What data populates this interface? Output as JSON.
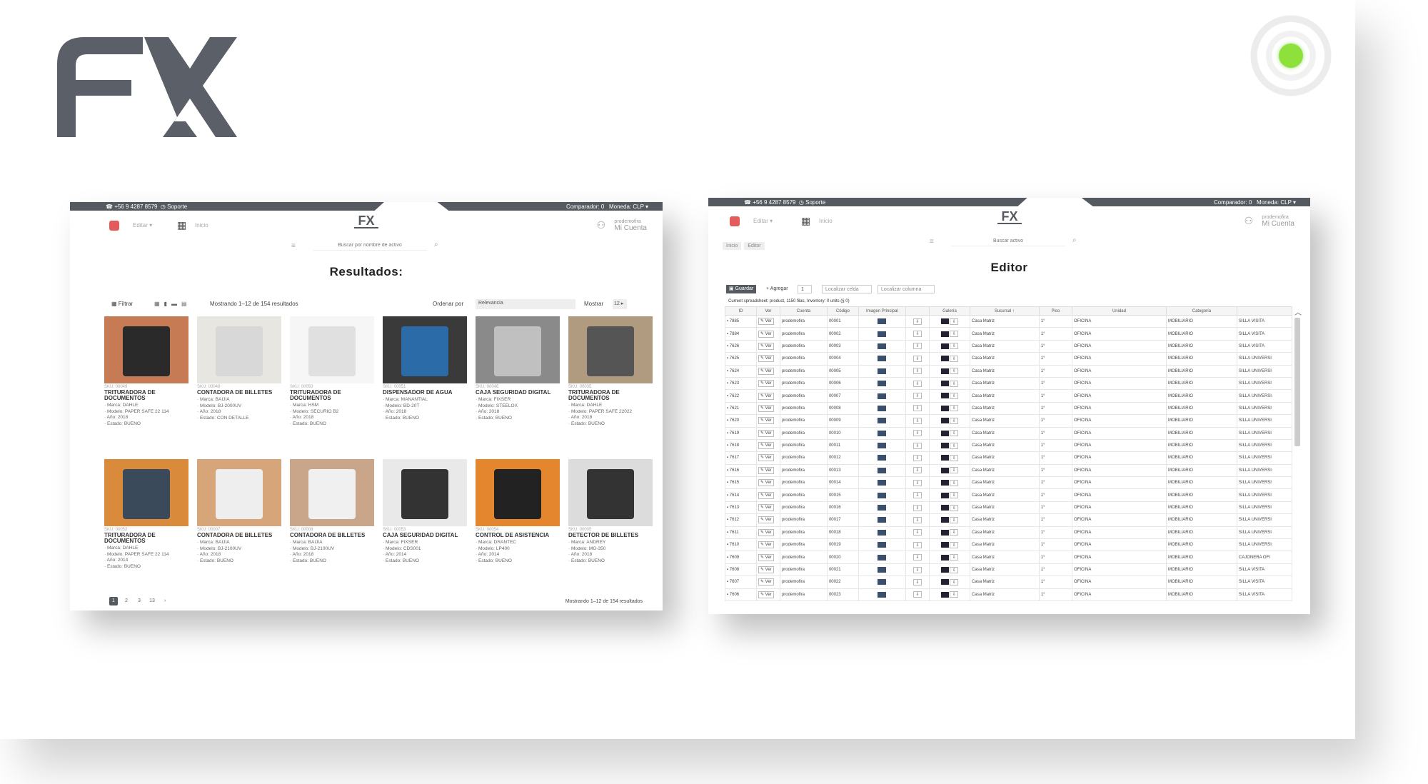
{
  "colors": {
    "dark_gray": "#555a61",
    "green_dot": "#8ee03b",
    "red_menu": "#e35b5b"
  },
  "logo": {
    "text": "FX"
  },
  "catalog": {
    "topbar": {
      "phone": "☎ +56 9 4287 8579",
      "support": "◷ Soporte",
      "comparator": "Comparador: 0",
      "currency": "Moneda: CLP ▾"
    },
    "menu_label": "Editar ▾",
    "home_label": "Inicio",
    "account": {
      "small": "prodemofira",
      "label": "Mi Cuenta"
    },
    "search_placeholder": "Buscar por nombre de activo",
    "title": "Resultados:",
    "filter": "▦ Filtrar",
    "view_icons": "▦▮▬▤",
    "showing": "Mostrando 1–12 de 154 resultados",
    "order_label": "Ordenar por",
    "order_value": "Relevancia",
    "show_label": "Mostrar",
    "show_value": "12 ▸",
    "products": [
      {
        "sku": "SKU: 00049",
        "title": "TRITURADORA DE DOCUMENTOS",
        "specs": [
          "Marca: DAHLE",
          "Modelo: PAPER SAFE 22 114",
          "Año: 2018",
          "Estado: BUENO"
        ],
        "bg": "#c77b55",
        "obj": "#2a2a2a"
      },
      {
        "sku": "SKU: 00048",
        "title": "CONTADORA DE BILLETES",
        "specs": [
          "Marca: BAIJIA",
          "Modelo: BJ-2000UV",
          "Año: 2018",
          "Estado: CON DETALLE"
        ],
        "bg": "#e8e6e0",
        "obj": "#d8d8d8"
      },
      {
        "sku": "SKU: 00050",
        "title": "TRITURADORA DE DOCUMENTOS",
        "specs": [
          "Marca: HSM",
          "Modelo: SECURIO B2",
          "Año: 2018",
          "Estado: BUENO"
        ],
        "bg": "#f6f6f6",
        "obj": "#e0e0e0"
      },
      {
        "sku": "SKU: 00051",
        "title": "DISPENSADOR DE AGUA",
        "specs": [
          "Marca: MANANTIAL",
          "Modelo: BD-20T",
          "Año: 2018",
          "Estado: BUENO"
        ],
        "bg": "#3a3a3a",
        "obj": "#2b6ca8"
      },
      {
        "sku": "SKU: 00046",
        "title": "CAJA SEGURIDAD DIGITAL",
        "specs": [
          "Marca: FIXSER",
          "Modelo: STEELOX",
          "Año: 2018",
          "Estado: BUENO"
        ],
        "bg": "#8a8a8a",
        "obj": "#c0c0c0"
      },
      {
        "sku": "SKU: 00035",
        "title": "TRITURADORA DE DOCUMENTOS",
        "specs": [
          "Marca: DAHLE",
          "Modelo: PAPER SAFE 22022",
          "Año: 2018",
          "Estado: BUENO"
        ],
        "bg": "#b09a80",
        "obj": "#555"
      },
      {
        "sku": "SKU: 00052",
        "title": "TRITURADORA DE DOCUMENTOS",
        "specs": [
          "Marca: DAHLE",
          "Modelo: PAPER SAFE 22 114",
          "Año: 2014",
          "Estado: BUENO"
        ],
        "bg": "#d98a3a",
        "obj": "#3a4a5a"
      },
      {
        "sku": "SKU: 00007",
        "title": "CONTADORA DE BILLETES",
        "specs": [
          "Marca: BAIJIA",
          "Modelo: BJ-2100UV",
          "Año: 2018",
          "Estado: BUENO"
        ],
        "bg": "#d7a57a",
        "obj": "#eee"
      },
      {
        "sku": "SKU: 00008",
        "title": "CONTADORA DE BILLETES",
        "specs": [
          "Marca: BAIJIA",
          "Modelo: BJ-2100UV",
          "Año: 2018",
          "Estado: BUENO"
        ],
        "bg": "#c9a58a",
        "obj": "#f0f0f0"
      },
      {
        "sku": "SKU: 00053",
        "title": "CAJA SEGURIDAD DIGITAL",
        "specs": [
          "Marca: FIXSER",
          "Modelo: CDS001",
          "Año: 2014",
          "Estado: BUENO"
        ],
        "bg": "#e9e9e9",
        "obj": "#333"
      },
      {
        "sku": "SKU: 00054",
        "title": "CONTROL DE ASISTENCIA",
        "specs": [
          "Marca: DRANTEC",
          "Modelo: LP400",
          "Año: 2014",
          "Estado: BUENO"
        ],
        "bg": "#e3862e",
        "obj": "#222"
      },
      {
        "sku": "SKU: 00005",
        "title": "DETECTOR DE BILLETES",
        "specs": [
          "Marca: ANDREY",
          "Modelo: MG-350",
          "Año: 2018",
          "Estado: BUENO"
        ],
        "bg": "#dcdcdc",
        "obj": "#333"
      }
    ],
    "pager": [
      "1",
      "2",
      "3",
      "13",
      "›"
    ],
    "footer_count": "Mostrando 1–12 de 154 resultados"
  },
  "editor": {
    "topbar": {
      "phone": "☎ +56 9 4287 8579",
      "support": "◷ Soporte",
      "comparator": "Comparador: 0",
      "currency": "Moneda: CLP ▾"
    },
    "menu_label": "Editar ▾",
    "home_label": "Inicio",
    "account": {
      "small": "prodemofira",
      "label": "Mi Cuenta"
    },
    "search_placeholder": "Buscar activo",
    "breadcrumbs": [
      "Inicio",
      "Editor"
    ],
    "title": "Editor",
    "save": "▣ Guardar",
    "add": "+ Agregar",
    "add_count": "1",
    "locate_cell": "Localizar celda",
    "locate_column": "Localizar columna",
    "sheet_info": "Current spreadsheet: product, 1150 filas, Inventory: 0 units (§ 0)",
    "columns": [
      "ID",
      "Ver",
      "Cuenta",
      "Código",
      "Imagen Principal",
      "",
      "Galería",
      "Sucursal ↑",
      "Piso",
      "Unidad",
      "Categoría",
      ""
    ],
    "view_label": "✎ Ver",
    "rows": [
      {
        "id": "7885",
        "cuenta": "prodemofira",
        "codigo": "00001",
        "sucursal": "Casa Matriz",
        "piso": "1°",
        "unidad": "OFICINA",
        "categoria": "MOBILIARIO",
        "sub": "SILLA VISITA"
      },
      {
        "id": "7884",
        "cuenta": "prodemofira",
        "codigo": "00002",
        "sucursal": "Casa Matriz",
        "piso": "1°",
        "unidad": "OFICINA",
        "categoria": "MOBILIARIO",
        "sub": "SILLA VISITA"
      },
      {
        "id": "7626",
        "cuenta": "prodemofira",
        "codigo": "00003",
        "sucursal": "Casa Matriz",
        "piso": "1°",
        "unidad": "OFICINA",
        "categoria": "MOBILIARIO",
        "sub": "SILLA VISITA"
      },
      {
        "id": "7625",
        "cuenta": "prodemofira",
        "codigo": "00004",
        "sucursal": "Casa Matriz",
        "piso": "1°",
        "unidad": "OFICINA",
        "categoria": "MOBILIARIO",
        "sub": "SILLA UNIVERSI"
      },
      {
        "id": "7624",
        "cuenta": "prodemofira",
        "codigo": "00005",
        "sucursal": "Casa Matriz",
        "piso": "1°",
        "unidad": "OFICINA",
        "categoria": "MOBILIARIO",
        "sub": "SILLA UNIVERSI"
      },
      {
        "id": "7623",
        "cuenta": "prodemofira",
        "codigo": "00006",
        "sucursal": "Casa Matriz",
        "piso": "1°",
        "unidad": "OFICINA",
        "categoria": "MOBILIARIO",
        "sub": "SILLA UNIVERSI"
      },
      {
        "id": "7622",
        "cuenta": "prodemofira",
        "codigo": "00007",
        "sucursal": "Casa Matriz",
        "piso": "1°",
        "unidad": "OFICINA",
        "categoria": "MOBILIARIO",
        "sub": "SILLA UNIVERSI"
      },
      {
        "id": "7621",
        "cuenta": "prodemofira",
        "codigo": "00008",
        "sucursal": "Casa Matriz",
        "piso": "1°",
        "unidad": "OFICINA",
        "categoria": "MOBILIARIO",
        "sub": "SILLA UNIVERSI"
      },
      {
        "id": "7620",
        "cuenta": "prodemofira",
        "codigo": "00009",
        "sucursal": "Casa Matriz",
        "piso": "1°",
        "unidad": "OFICINA",
        "categoria": "MOBILIARIO",
        "sub": "SILLA UNIVERSI"
      },
      {
        "id": "7619",
        "cuenta": "prodemofira",
        "codigo": "00010",
        "sucursal": "Casa Matriz",
        "piso": "1°",
        "unidad": "OFICINA",
        "categoria": "MOBILIARIO",
        "sub": "SILLA UNIVERSI"
      },
      {
        "id": "7618",
        "cuenta": "prodemofira",
        "codigo": "00011",
        "sucursal": "Casa Matriz",
        "piso": "1°",
        "unidad": "OFICINA",
        "categoria": "MOBILIARIO",
        "sub": "SILLA UNIVERSI"
      },
      {
        "id": "7617",
        "cuenta": "prodemofira",
        "codigo": "00012",
        "sucursal": "Casa Matriz",
        "piso": "1°",
        "unidad": "OFICINA",
        "categoria": "MOBILIARIO",
        "sub": "SILLA UNIVERSI"
      },
      {
        "id": "7616",
        "cuenta": "prodemofira",
        "codigo": "00013",
        "sucursal": "Casa Matriz",
        "piso": "1°",
        "unidad": "OFICINA",
        "categoria": "MOBILIARIO",
        "sub": "SILLA UNIVERSI"
      },
      {
        "id": "7615",
        "cuenta": "prodemofira",
        "codigo": "00014",
        "sucursal": "Casa Matriz",
        "piso": "1°",
        "unidad": "OFICINA",
        "categoria": "MOBILIARIO",
        "sub": "SILLA UNIVERSI"
      },
      {
        "id": "7614",
        "cuenta": "prodemofira",
        "codigo": "00015",
        "sucursal": "Casa Matriz",
        "piso": "1°",
        "unidad": "OFICINA",
        "categoria": "MOBILIARIO",
        "sub": "SILLA UNIVERSI"
      },
      {
        "id": "7613",
        "cuenta": "prodemofira",
        "codigo": "00016",
        "sucursal": "Casa Matriz",
        "piso": "1°",
        "unidad": "OFICINA",
        "categoria": "MOBILIARIO",
        "sub": "SILLA UNIVERSI"
      },
      {
        "id": "7612",
        "cuenta": "prodemofira",
        "codigo": "00017",
        "sucursal": "Casa Matriz",
        "piso": "1°",
        "unidad": "OFICINA",
        "categoria": "MOBILIARIO",
        "sub": "SILLA UNIVERSI"
      },
      {
        "id": "7611",
        "cuenta": "prodemofira",
        "codigo": "00018",
        "sucursal": "Casa Matriz",
        "piso": "1°",
        "unidad": "OFICINA",
        "categoria": "MOBILIARIO",
        "sub": "SILLA UNIVERSI"
      },
      {
        "id": "7610",
        "cuenta": "prodemofira",
        "codigo": "00019",
        "sucursal": "Casa Matriz",
        "piso": "1°",
        "unidad": "OFICINA",
        "categoria": "MOBILIARIO",
        "sub": "SILLA UNIVERSI"
      },
      {
        "id": "7609",
        "cuenta": "prodemofira",
        "codigo": "00020",
        "sucursal": "Casa Matriz",
        "piso": "1°",
        "unidad": "OFICINA",
        "categoria": "MOBILIARIO",
        "sub": "CAJONERA OFI"
      },
      {
        "id": "7608",
        "cuenta": "prodemofira",
        "codigo": "00021",
        "sucursal": "Casa Matriz",
        "piso": "1°",
        "unidad": "OFICINA",
        "categoria": "MOBILIARIO",
        "sub": "SILLA VISITA"
      },
      {
        "id": "7607",
        "cuenta": "prodemofira",
        "codigo": "00022",
        "sucursal": "Casa Matriz",
        "piso": "1°",
        "unidad": "OFICINA",
        "categoria": "MOBILIARIO",
        "sub": "SILLA VISITA"
      },
      {
        "id": "7606",
        "cuenta": "prodemofira",
        "codigo": "00023",
        "sucursal": "Casa Matriz",
        "piso": "1°",
        "unidad": "OFICINA",
        "categoria": "MOBILIARIO",
        "sub": "SILLA VISITA"
      }
    ]
  }
}
